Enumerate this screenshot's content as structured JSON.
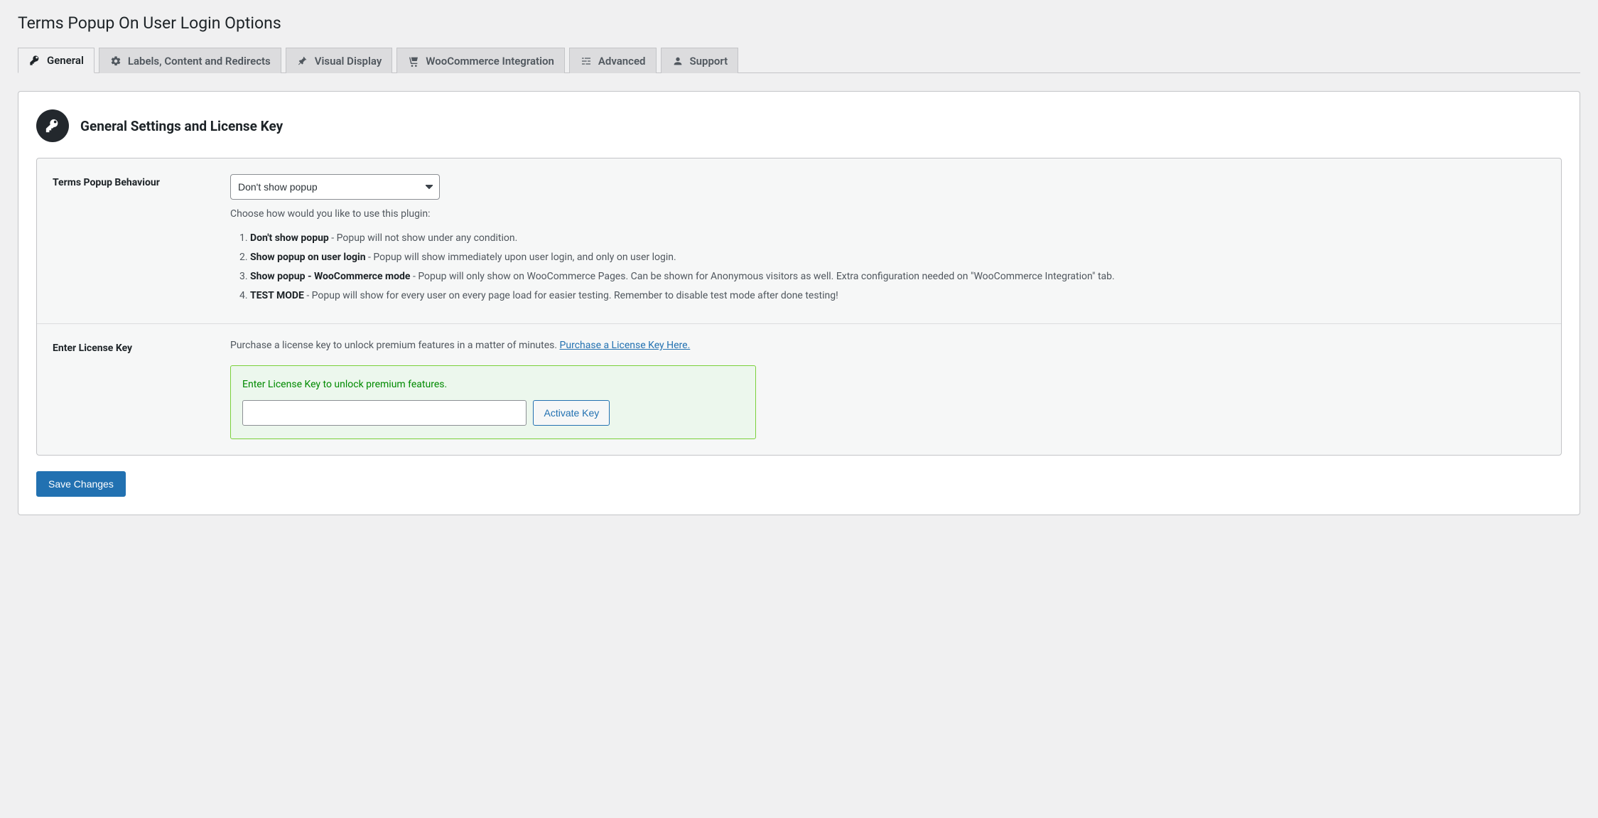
{
  "page_title": "Terms Popup On User Login Options",
  "tabs": [
    {
      "label": "General",
      "icon": "key"
    },
    {
      "label": "Labels, Content and Redirects",
      "icon": "gear"
    },
    {
      "label": "Visual Display",
      "icon": "pin"
    },
    {
      "label": "WooCommerce Integration",
      "icon": "cart"
    },
    {
      "label": "Advanced",
      "icon": "sliders"
    },
    {
      "label": "Support",
      "icon": "person"
    }
  ],
  "section": {
    "title": "General Settings and License Key"
  },
  "behaviour": {
    "label": "Terms Popup Behaviour",
    "selected": "Don't show popup",
    "help": "Choose how would you like to use this plugin:",
    "options": [
      {
        "bold": "Don't show popup",
        "rest": " - Popup will not show under any condition."
      },
      {
        "bold": "Show popup on user login",
        "rest": " - Popup will show immediately upon user login, and only on user login."
      },
      {
        "bold": "Show popup - WooCommerce mode",
        "rest": " - Popup will only show on WooCommerce Pages. Can be shown for Anonymous visitors as well. Extra configuration needed on \"WooCommerce Integration\" tab."
      },
      {
        "bold": "TEST MODE",
        "rest": " - Popup will show for every user on every page load for easier testing. Remember to disable test mode after done testing!"
      }
    ]
  },
  "license": {
    "label": "Enter License Key",
    "prompt_pre": "Purchase a license key to unlock premium features in a matter of minutes. ",
    "prompt_link": "Purchase a License Key Here.",
    "box_msg": "Enter License Key to unlock premium features.",
    "activate_label": "Activate Key"
  },
  "save_label": "Save Changes",
  "colors": {
    "primary": "#2271b1",
    "success": "#008a00"
  }
}
